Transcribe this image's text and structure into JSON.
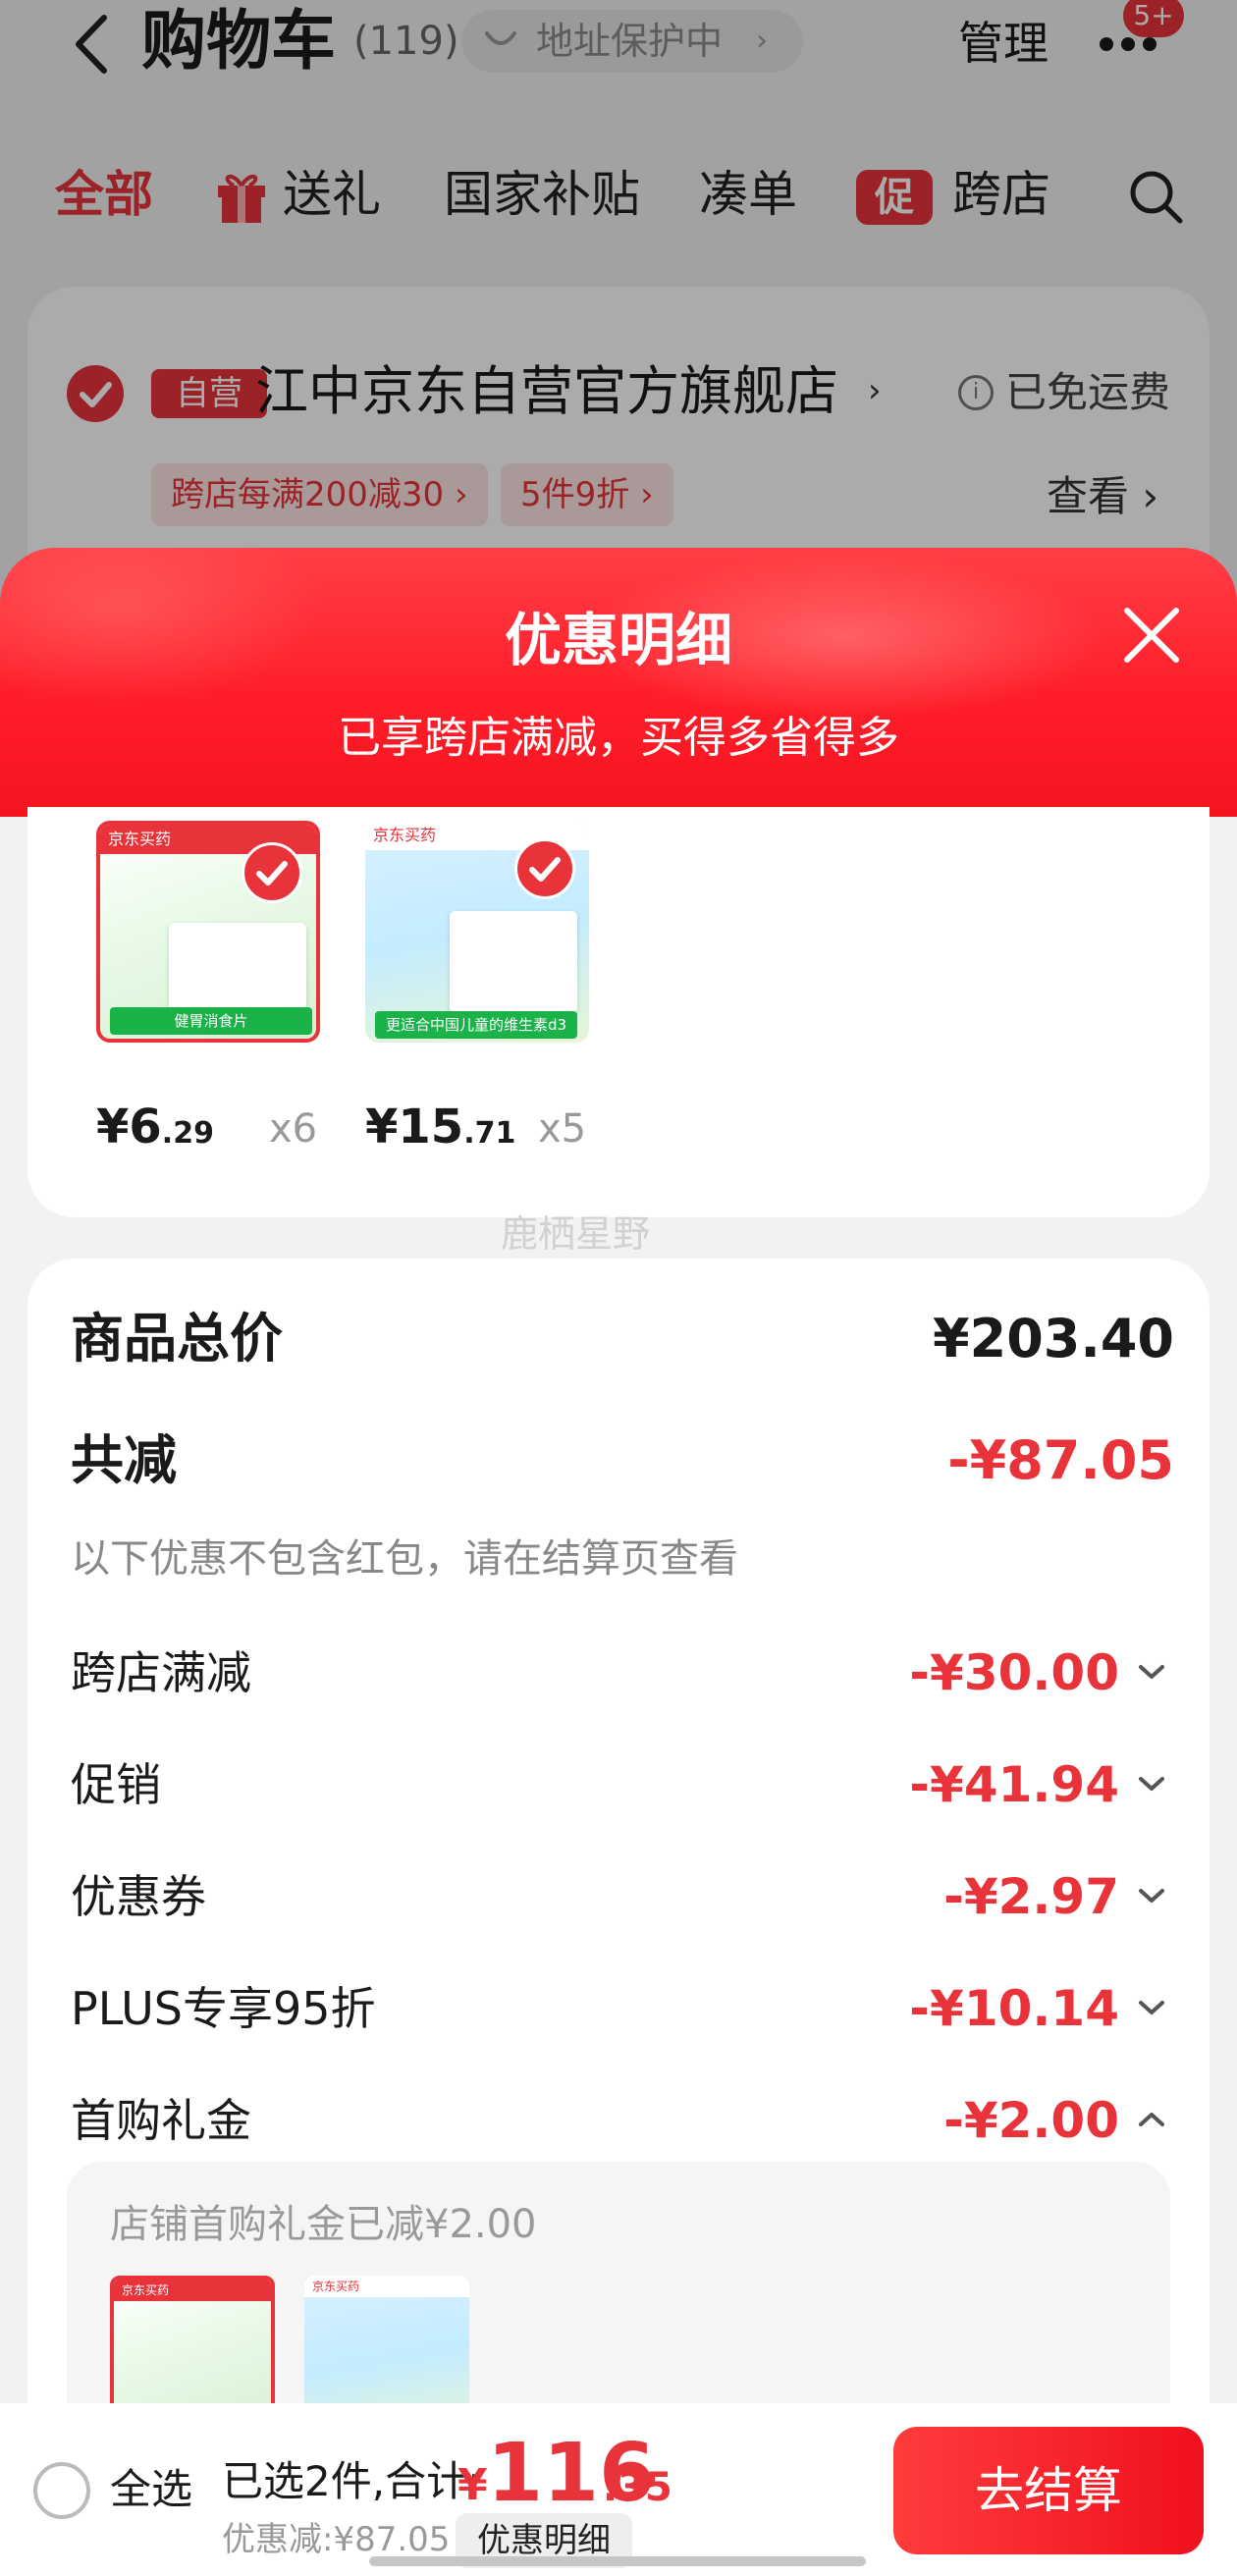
{
  "header": {
    "title": "购物车",
    "count": "(119)",
    "address_label": "地址保护中",
    "manage_label": "管理",
    "badge": "5+"
  },
  "tabs": [
    {
      "label": "全部"
    },
    {
      "label": "送礼"
    },
    {
      "label": "国家补贴"
    },
    {
      "label": "凑单"
    },
    {
      "label": "跨店"
    }
  ],
  "promo_icon": "促",
  "store": {
    "self_tag": "自营",
    "name": "江中京东自营官方旗舰店",
    "shipping": "已免运费",
    "coupons": [
      "跨店每满200减30 ›",
      "5件9折 ›"
    ],
    "view_label": "查看 ›"
  },
  "sheet": {
    "title": "优惠明细",
    "subtitle": "已享跨店满减，买得多省得多"
  },
  "products": [
    {
      "price_int": "¥6",
      "price_dec": ".29",
      "qty": "x6",
      "banner": "京东买药",
      "strip": "健胃消食片"
    },
    {
      "price_int": "¥15",
      "price_dec": ".71",
      "qty": "x5",
      "banner": "京东买药",
      "strip": "更适合中国儿童的维生素d3"
    }
  ],
  "watermark": "鹿栖星野",
  "breakdown": {
    "total_label": "商品总价",
    "total_value": "¥203.40",
    "reduce_label": "共减",
    "reduce_value": "-¥87.05",
    "note": "以下优惠不包含红包，请在结算页查看",
    "items": [
      {
        "label": "跨店满减",
        "value": "-¥30.00"
      },
      {
        "label": "促销",
        "value": "-¥41.94"
      },
      {
        "label": "优惠券",
        "value": "-¥2.97"
      },
      {
        "label": "PLUS专享95折",
        "value": "-¥10.14"
      },
      {
        "label": "首购礼金",
        "value": "-¥2.00"
      }
    ],
    "gift_note": "店铺首购礼金已减¥2.00"
  },
  "bottom": {
    "select_all": "全选",
    "summary": "已选2件,合计:",
    "currency": "¥",
    "total_int": "116",
    "total_dec": ".35",
    "discount": "优惠减:¥87.05",
    "detail_button": "优惠明细",
    "checkout_button": "去结算"
  },
  "colors": {
    "accent": "#e8333a",
    "sheet_header": "#ff1e2a"
  }
}
